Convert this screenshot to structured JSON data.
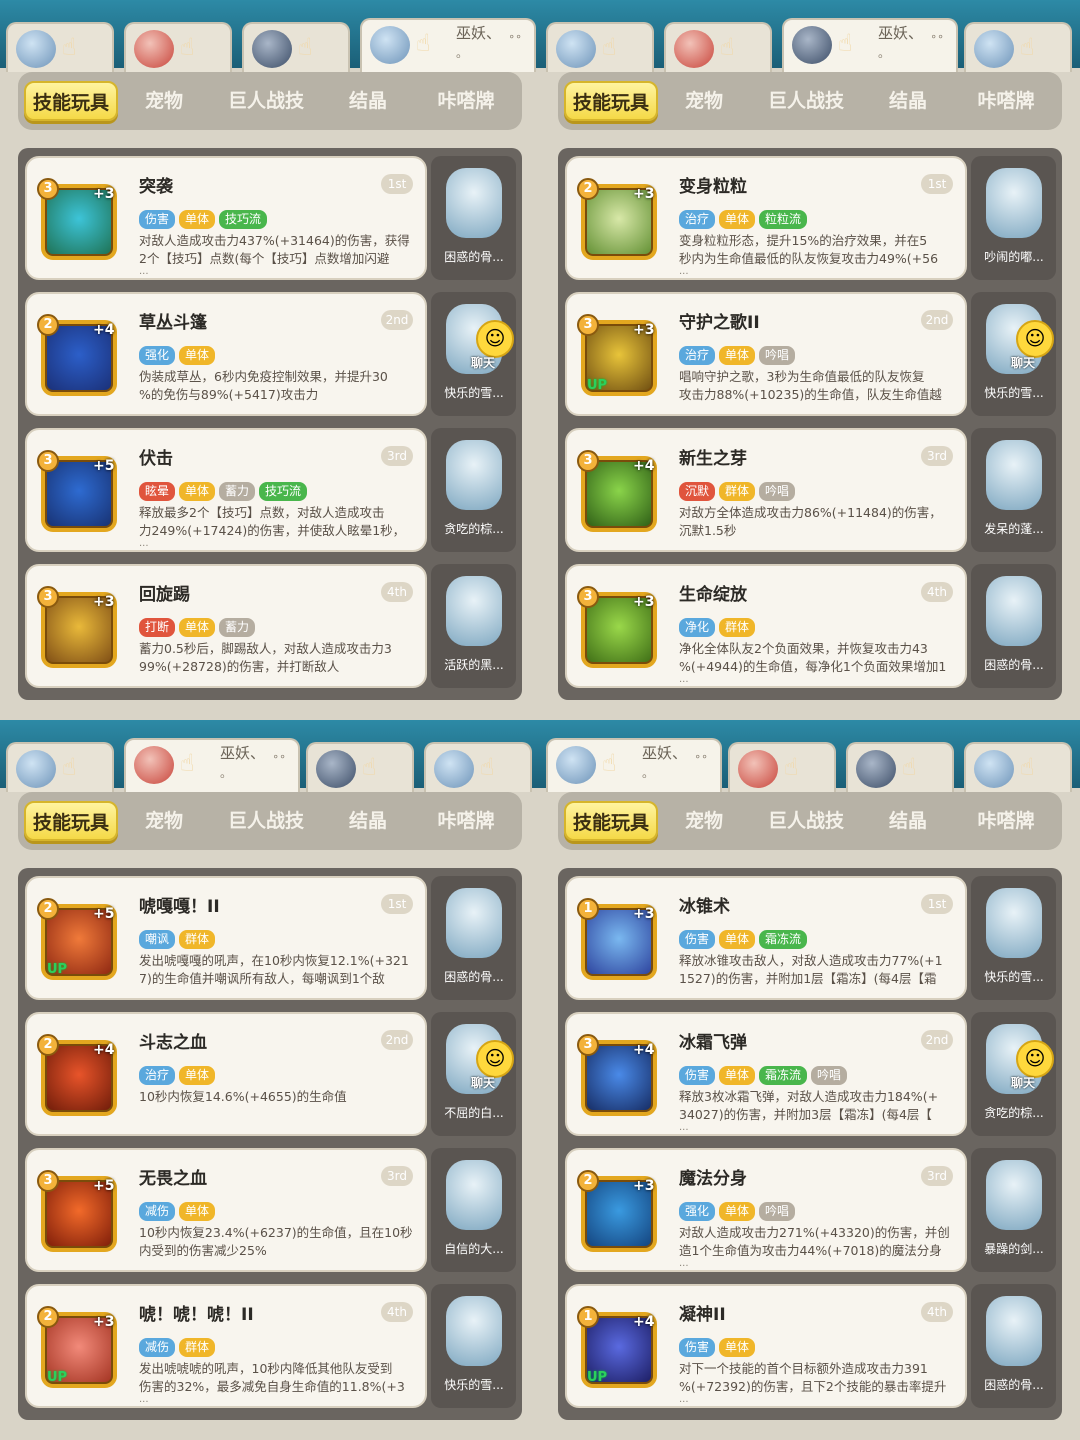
{
  "colors": {
    "tag_blue": "#5aa8dd",
    "tag_yellow": "#f0b629",
    "tag_gray": "#b5ada0",
    "tag_green": "#49b64c",
    "tag_red": "#e0553d",
    "highlight": "#28a44a"
  },
  "panels": [
    {
      "char_tabs": [
        {
          "name": "",
          "sub": ""
        },
        {
          "name": "",
          "sub": ""
        },
        {
          "name": "",
          "sub": ""
        },
        {
          "name": "巫妖、",
          "sub": "。"
        }
      ],
      "active_char": 3,
      "menu": [
        "技能玩具",
        "宠物",
        "巨人战技",
        "结晶",
        "咔嗒牌"
      ],
      "skills": [
        {
          "name": "突袭",
          "rank": "1st",
          "lvl": "3",
          "plus": "+3",
          "up": "",
          "tags": [
            [
              "伤害",
              "blue"
            ],
            [
              "单体",
              "yellow"
            ],
            [
              "技巧流",
              "green"
            ]
          ],
          "l1": "对敌人造成攻击力437%(+31464)的伤害，获得",
          "l2": "2个【技巧】点数(每个【技巧】点数增加闪避",
          "more": "...",
          "pet": "困惑的骨...",
          "chat": false,
          "c1": "#3dc4d8",
          "c2": "#1d6e4e"
        },
        {
          "name": "草丛斗篷",
          "rank": "2nd",
          "lvl": "2",
          "plus": "+4",
          "up": "",
          "tags": [
            [
              "强化",
              "blue"
            ],
            [
              "单体",
              "yellow"
            ]
          ],
          "l1": "伪装成草丛，6秒内免疫控制效果，并提升30",
          "l2": "%的免伤与89%(+5417)攻击力",
          "more": "",
          "pet": "快乐的雪...",
          "chat": true,
          "c1": "#2c5fc9",
          "c2": "#1a2e74"
        },
        {
          "name": "伏击",
          "rank": "3rd",
          "lvl": "3",
          "plus": "+5",
          "up": "",
          "tags": [
            [
              "眩晕",
              "red"
            ],
            [
              "单体",
              "yellow"
            ],
            [
              "蓄力",
              "gray"
            ],
            [
              "技巧流",
              "green"
            ]
          ],
          "l1": "释放最多2个【技巧】点数，对敌人造成攻击",
          "l2": "力249%(+17424)的伤害，并使敌人眩晕1秒，",
          "more": "...",
          "pet": "贪吃的棕...",
          "chat": false,
          "c1": "#2e6bd1",
          "c2": "#172f6e"
        },
        {
          "name": "回旋踢",
          "rank": "4th",
          "lvl": "3",
          "plus": "+3",
          "up": "",
          "tags": [
            [
              "打断",
              "red"
            ],
            [
              "单体",
              "yellow"
            ],
            [
              "蓄力",
              "gray"
            ]
          ],
          "l1": "蓄力0.5秒后，脚踢敌人，对敌人造成攻击力3",
          "l2": "99%(+28728)的伤害，并打断敌人",
          "more": "",
          "pet": "活跃的黑...",
          "chat": false,
          "c1": "#e9b93a",
          "c2": "#7b4a14"
        }
      ]
    },
    {
      "char_tabs": [
        {
          "name": "",
          "sub": ""
        },
        {
          "name": "",
          "sub": ""
        },
        {
          "name": "巫妖、",
          "sub": "。"
        },
        {
          "name": "",
          "sub": ""
        }
      ],
      "active_char": 2,
      "menu": [
        "技能玩具",
        "宠物",
        "巨人战技",
        "结晶",
        "咔嗒牌"
      ],
      "skills": [
        {
          "name": "变身粒粒",
          "rank": "1st",
          "lvl": "2",
          "plus": "+3",
          "up": "",
          "tags": [
            [
              "治疗",
              "blue"
            ],
            [
              "单体",
              "yellow"
            ],
            [
              "粒粒流",
              "green"
            ]
          ],
          "l1": "变身粒粒形态，提升15%的治疗效果，并在5",
          "l2": "秒内为生命值最低的队友恢复攻击力49%(+56",
          "more": "...",
          "pet": "吵闹的嘟...",
          "chat": false,
          "c1": "#d8e8a8",
          "c2": "#5d8c2e"
        },
        {
          "name": "守护之歌II",
          "rank": "2nd",
          "lvl": "3",
          "plus": "+3",
          "up": "UP",
          "tags": [
            [
              "治疗",
              "blue"
            ],
            [
              "单体",
              "yellow"
            ],
            [
              "吟唱",
              "gray"
            ]
          ],
          "l1": "唱响守护之歌，3秒为生命值最低的队友恢复",
          "l2": "攻击力88%(+10235)的生命值，队友生命值越",
          "more": "",
          "pet": "快乐的雪...",
          "chat": true,
          "c1": "#e8c43a",
          "c2": "#6b4a10"
        },
        {
          "name": "新生之芽",
          "rank": "3rd",
          "lvl": "3",
          "plus": "+4",
          "up": "",
          "tags": [
            [
              "沉默",
              "red"
            ],
            [
              "群体",
              "yellow"
            ],
            [
              "吟唱",
              "gray"
            ]
          ],
          "l1": "对敌方全体造成攻击力86%(+11484)的伤害，",
          "l2": "沉默1.5秒",
          "more": "",
          "pet": "发呆的蓬...",
          "chat": false,
          "c1": "#8ad44a",
          "c2": "#2b5a14"
        },
        {
          "name": "生命绽放",
          "rank": "4th",
          "lvl": "3",
          "plus": "+3",
          "up": "",
          "tags": [
            [
              "净化",
              "blue"
            ],
            [
              "群体",
              "yellow"
            ]
          ],
          "l1": "净化全体队友2个负面效果，并恢复攻击力43",
          "l2": "%(+4944)的生命值，每净化1个负面效果增加1",
          "more": "...",
          "pet": "困惑的骨...",
          "chat": false,
          "c1": "#9ad84a",
          "c2": "#3b6a14"
        }
      ]
    },
    {
      "char_tabs": [
        {
          "name": "",
          "sub": ""
        },
        {
          "name": "巫妖、",
          "sub": "。"
        },
        {
          "name": "",
          "sub": ""
        },
        {
          "name": "",
          "sub": ""
        }
      ],
      "active_char": 1,
      "menu": [
        "技能玩具",
        "宠物",
        "巨人战技",
        "结晶",
        "咔嗒牌"
      ],
      "skills": [
        {
          "name": "唬嘎嘎！II",
          "rank": "1st",
          "lvl": "2",
          "plus": "+5",
          "up": "UP",
          "tags": [
            [
              "嘲讽",
              "blue"
            ],
            [
              "群体",
              "yellow"
            ]
          ],
          "l1": "发出唬嘎嘎的吼声，在10秒内恢复12.1%(+321",
          "l2": "7)的生命值并嘲讽所有敌人，每嘲讽到1个敌",
          "more": "",
          "pet": "困惑的骨...",
          "chat": false,
          "c1": "#f07a3a",
          "c2": "#8a2410"
        },
        {
          "name": "斗志之血",
          "rank": "2nd",
          "lvl": "2",
          "plus": "+4",
          "up": "",
          "tags": [
            [
              "治疗",
              "blue"
            ],
            [
              "单体",
              "yellow"
            ]
          ],
          "l1": "10秒内恢复14.6%(+4655)的生命值",
          "l2": "",
          "more": "",
          "pet": "不屈的白...",
          "chat": true,
          "c1": "#e8542a",
          "c2": "#6a1a08"
        },
        {
          "name": "无畏之血",
          "rank": "3rd",
          "lvl": "3",
          "plus": "+5",
          "up": "",
          "tags": [
            [
              "减伤",
              "blue"
            ],
            [
              "单体",
              "yellow"
            ]
          ],
          "l1": "10秒内恢复23.4%(+6237)的生命值，且在10秒",
          "l2": "内受到的伤害减少25%",
          "more": "",
          "pet": "自信的大...",
          "chat": false,
          "c1": "#f26a2a",
          "c2": "#7a1a08"
        },
        {
          "name": "唬！唬！唬！II",
          "rank": "4th",
          "lvl": "2",
          "plus": "+3",
          "up": "UP",
          "tags": [
            [
              "减伤",
              "blue"
            ],
            [
              "群体",
              "yellow"
            ]
          ],
          "l1": "发出唬唬唬的吼声，10秒内降低其他队友受到",
          "l2": "伤害的32%，最多减免自身生命值的11.8%(+3",
          "more": "...",
          "pet": "快乐的雪...",
          "chat": false,
          "c1": "#f28a7a",
          "c2": "#a0301e"
        }
      ]
    },
    {
      "char_tabs": [
        {
          "name": "巫妖、",
          "sub": "。"
        },
        {
          "name": "",
          "sub": ""
        },
        {
          "name": "",
          "sub": ""
        },
        {
          "name": "",
          "sub": ""
        }
      ],
      "active_char": 0,
      "menu": [
        "技能玩具",
        "宠物",
        "巨人战技",
        "结晶",
        "咔嗒牌"
      ],
      "skills": [
        {
          "name": "冰锥术",
          "rank": "1st",
          "lvl": "1",
          "plus": "+3",
          "up": "",
          "tags": [
            [
              "伤害",
              "blue"
            ],
            [
              "单体",
              "yellow"
            ],
            [
              "霜冻流",
              "green"
            ]
          ],
          "l1": "释放冰锥攻击敌人，对敌人造成攻击力77%(+1",
          "l2": "1527)的伤害，并附加1层【霜冻】(每4层【霜",
          "more": "",
          "pet": "快乐的雪...",
          "chat": false,
          "c1": "#7ab8f0",
          "c2": "#2a3e9a"
        },
        {
          "name": "冰霜飞弹",
          "rank": "2nd",
          "lvl": "3",
          "plus": "+4",
          "up": "",
          "tags": [
            [
              "伤害",
              "blue"
            ],
            [
              "单体",
              "yellow"
            ],
            [
              "霜冻流",
              "green"
            ],
            [
              "吟唱",
              "gray"
            ]
          ],
          "l1": "释放3枚冰霜飞弹，对敌人造成攻击力184%(+",
          "l2": "34027)的伤害，并附加3层【霜冻】(每4层【",
          "more": "...",
          "pet": "贪吃的棕...",
          "chat": true,
          "c1": "#4a8ae8",
          "c2": "#14285e"
        },
        {
          "name": "魔法分身",
          "rank": "3rd",
          "lvl": "2",
          "plus": "+3",
          "up": "",
          "tags": [
            [
              "强化",
              "blue"
            ],
            [
              "单体",
              "yellow"
            ],
            [
              "吟唱",
              "gray"
            ]
          ],
          "l1": "对敌人造成攻击力271%(+43320)的伤害，并创",
          "l2": "造1个生命值为攻击力44%(+7018)的魔法分身",
          "more": "...",
          "pet": "暴躁的剑...",
          "chat": false,
          "c1": "#3a9ae0",
          "c2": "#12407a"
        },
        {
          "name": "凝神II",
          "rank": "4th",
          "lvl": "1",
          "plus": "+4",
          "up": "UP",
          "tags": [
            [
              "伤害",
              "blue"
            ],
            [
              "单体",
              "yellow"
            ]
          ],
          "l1": "对下一个技能的首个目标额外造成攻击力391",
          "l2": "%(+72392)的伤害，且下2个技能的暴击率提升",
          "more": "...",
          "pet": "困惑的骨...",
          "chat": false,
          "c1": "#5a6ae0",
          "c2": "#1a1a5e"
        }
      ]
    }
  ]
}
